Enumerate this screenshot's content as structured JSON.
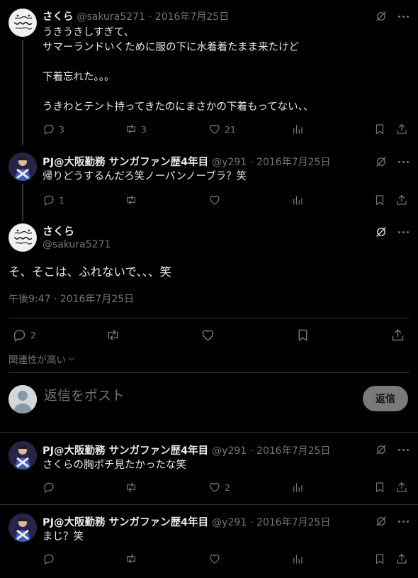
{
  "thread": [
    {
      "name": "さくら",
      "handle": "@sakura5271",
      "date": "· 2016年7月25日",
      "text": "うきうきしすぎて、\nサマーランドいくために服の下に水着着たまま来たけど\n\n下着忘れた。。。\n\nうきわとテント持ってきたのにまさかの下着もってない、、",
      "replies": "3",
      "retweets": "3",
      "likes": "21"
    },
    {
      "name": "PJ@大阪勤務 サンガファン歴4年目",
      "handle": "@y291",
      "date": "· 2016年7月25日",
      "text": "帰りどうするんだろ笑ノーパンノーブラ？笑",
      "replies": "1",
      "retweets": "",
      "likes": ""
    }
  ],
  "main": {
    "name": "さくら",
    "handle": "@sakura5271",
    "text": "そ、そこは、ふれないで、、、笑",
    "time": "午後9:47 · 2016年7月25日",
    "replies": "2"
  },
  "relevance_label": "関連性が高い",
  "reply_box": {
    "placeholder": "返信をポスト",
    "button_label": "返信"
  },
  "replies": [
    {
      "name": "PJ@大阪勤務 サンガファン歴4年目",
      "handle": "@y291",
      "date": "· 2016年7月25日",
      "text": "さくらの胸ポチ見たかったな笑",
      "replies": "",
      "retweets": "",
      "likes": "2"
    },
    {
      "name": "PJ@大阪勤務 サンガファン歴4年目",
      "handle": "@y291",
      "date": "· 2016年7月25日",
      "text": "まじ？笑",
      "replies": "",
      "retweets": "",
      "likes": ""
    }
  ],
  "colors": {
    "background": "#000000",
    "text": "#e7e9ea",
    "secondary": "#71767b",
    "divider": "#2f3336",
    "reply_button": "#787a7a"
  },
  "icons": [
    "grok-icon",
    "more-icon",
    "reply-icon",
    "retweet-icon",
    "like-icon",
    "views-icon",
    "bookmark-icon",
    "share-icon",
    "chevron-down-icon",
    "default-avatar-icon"
  ]
}
